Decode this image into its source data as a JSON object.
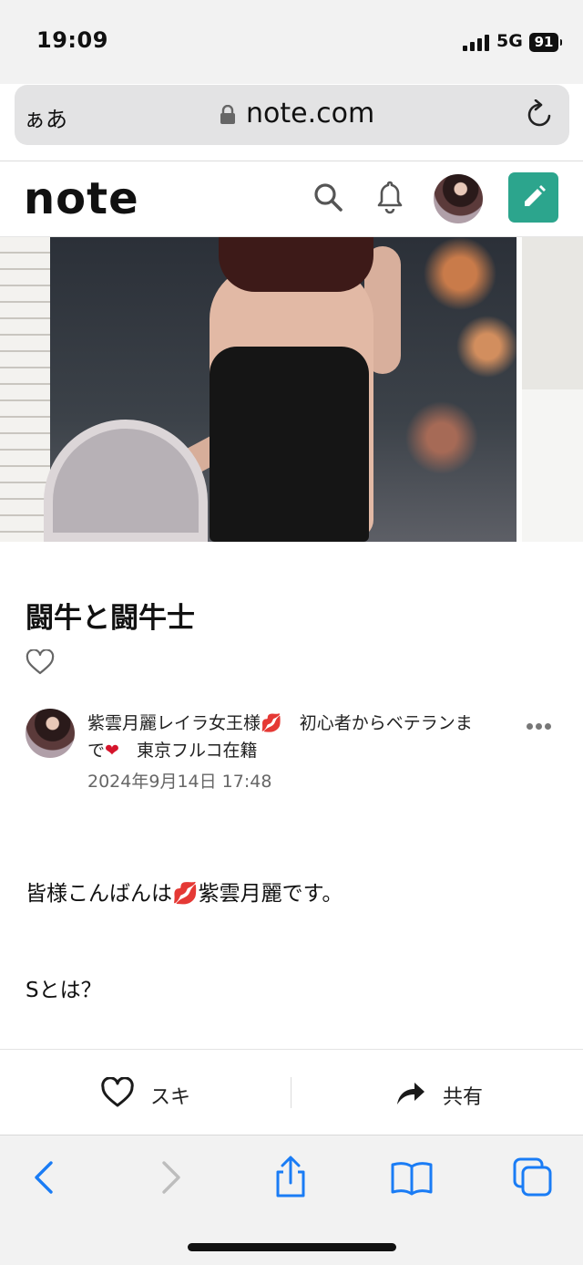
{
  "status": {
    "time": "19:09",
    "network": "5G",
    "battery": "91"
  },
  "browser": {
    "aa_label": "ぁあ",
    "url": "note.com"
  },
  "header": {
    "logo": "note"
  },
  "article": {
    "title": "闘牛と闘牛士",
    "author": {
      "name_line1": "紫雲月麗レイラ女王様",
      "name_line1b": "　初心者からベテランま",
      "name_line2a": "で",
      "name_line2b": "　東京フルコ在籍"
    },
    "date": "2024年9月14日 17:48",
    "paragraph1_a": "皆様こんばんは",
    "paragraph1_b": "紫雲月麗です。",
    "paragraph2": "Sとは？"
  },
  "actions": {
    "like_label": "スキ",
    "share_label": "共有"
  },
  "colors": {
    "accent": "#2ca58d",
    "safari_blue": "#1a7cf5",
    "kiss": "#d81b3a"
  }
}
